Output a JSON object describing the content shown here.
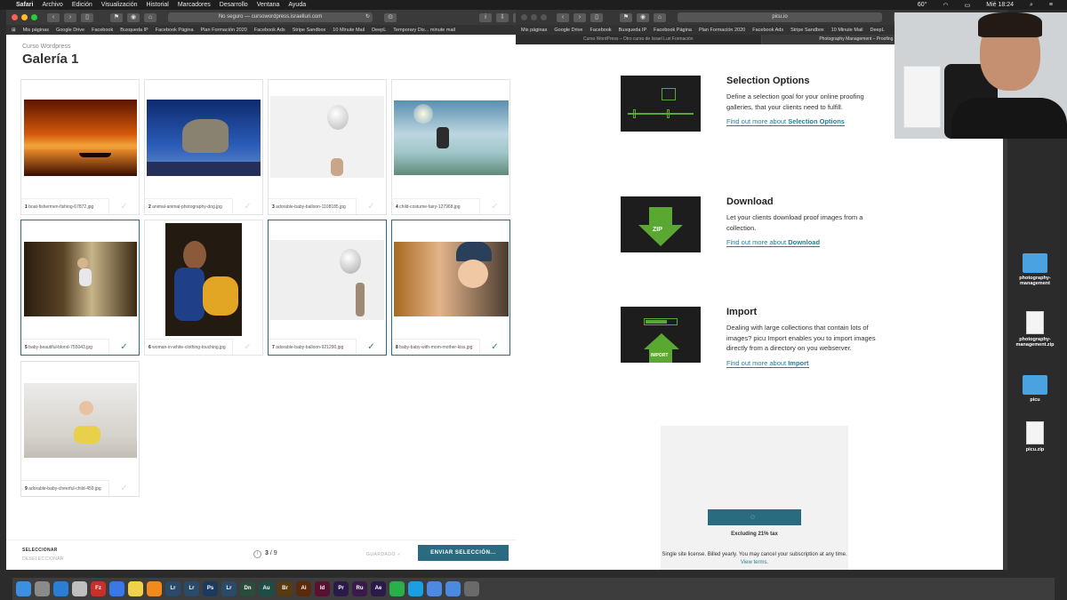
{
  "menubar": {
    "apple": "",
    "items": [
      "Safari",
      "Archivo",
      "Edición",
      "Visualización",
      "Historial",
      "Marcadores",
      "Desarrollo",
      "Ventana",
      "Ayuda"
    ],
    "clock": "Mié 18:24",
    "temp": "60°"
  },
  "left_window": {
    "url": "No seguro — cursowordpress.israelluri.com",
    "bookmarks": [
      "Mis páginas",
      "Google Drive",
      "Facebook",
      "Busqueda IP",
      "Facebook Página",
      "Plan Formación 2020",
      "Facebook Ads",
      "Stripe Sandbox",
      "10 Minute Mail",
      "DeepL",
      "Temporary Dis... minute mail"
    ],
    "gallery_sub": "Curso Wordpress",
    "gallery_title": "Galería 1",
    "items": [
      {
        "num": "1",
        "name": "boat-fishermen-fishing-67872.jpg",
        "selected": false
      },
      {
        "num": "2",
        "name": "animal-animal-photography-dog.jpg",
        "selected": false
      },
      {
        "num": "3",
        "name": "adorable-baby-balloon-1108185.jpg",
        "selected": false
      },
      {
        "num": "4",
        "name": "child-costume-fairy-127968.jpg",
        "selected": false
      },
      {
        "num": "5",
        "name": "baby-beautiful-blond-755043.jpg",
        "selected": true
      },
      {
        "num": "6",
        "name": "woman-in-white-clothing-touching.jpg",
        "selected": false
      },
      {
        "num": "7",
        "name": "adorable-baby-balloon-921290.jpg",
        "selected": true
      },
      {
        "num": "8",
        "name": "baby-baby-with-mom-mother-kiss.jpg",
        "selected": true
      },
      {
        "num": "9",
        "name": "adorable-baby-cheerful-child-459.jpg",
        "selected": false
      }
    ],
    "footer": {
      "select": "SELECCIONAR",
      "deselect": "DESELECCIONAR",
      "count": "3",
      "total": "/ 9",
      "saved": "GUARDADO ✓",
      "send": "ENVIAR SELECCIÓN..."
    }
  },
  "right_window": {
    "url": "picu.io",
    "bookmarks": [
      "Mis páginas",
      "Google Drive",
      "Facebook",
      "Busqueda IP",
      "Facebook Página",
      "Plan Formación 2020",
      "Facebook Ads",
      "Stripe Sandbox",
      "10 Minute Mail",
      "DeepL"
    ],
    "tabs": [
      "Curso WordPress – Otro curso de Israel Luri Formación",
      "Photography Management – Proofing • Image Protection • Gallery"
    ],
    "features": [
      {
        "title": "Selection Options",
        "desc": "Define a selection goal for your online proofing galleries, that your clients need to fulfill.",
        "link_pre": "Find out more about ",
        "link_bold": "Selection Options"
      },
      {
        "title": "Download",
        "desc": "Let your clients download proof images from a collection.",
        "link_pre": "Find out more about ",
        "link_bold": "Download"
      },
      {
        "title": "Import",
        "desc": "Dealing with large collections that contain lots of images? picu Import enables you to import images directly from a directory on you webserver.",
        "link_pre": "Find out more about ",
        "link_bold": "Import"
      }
    ],
    "zip_label": "ZIP",
    "import_label": "IMPORT",
    "price": {
      "excluding": "Excluding 21% tax",
      "license": "Single site license. Billed yearly. You may cancel your subscription at any time.",
      "terms": "View terms."
    }
  },
  "desktop": {
    "icons": [
      "photography-management",
      "photography-management.zip",
      "picu",
      "picu.zip"
    ]
  },
  "dock": {
    "apps": [
      "Finder",
      "Launchpad",
      "Safari",
      "Mail",
      "FileZilla",
      "Chrome",
      "Notes",
      "VLC",
      "Lr",
      "Lr",
      "Ps",
      "Lr",
      "Dn",
      "Au",
      "Br",
      "Ai",
      "Id",
      "Pr",
      "Ru",
      "Ae",
      "WhatsApp",
      "Skype",
      "Trash"
    ]
  },
  "colors": {
    "accent": "#2a6b82",
    "link": "#2a7f8c",
    "green": "#5aa832"
  }
}
